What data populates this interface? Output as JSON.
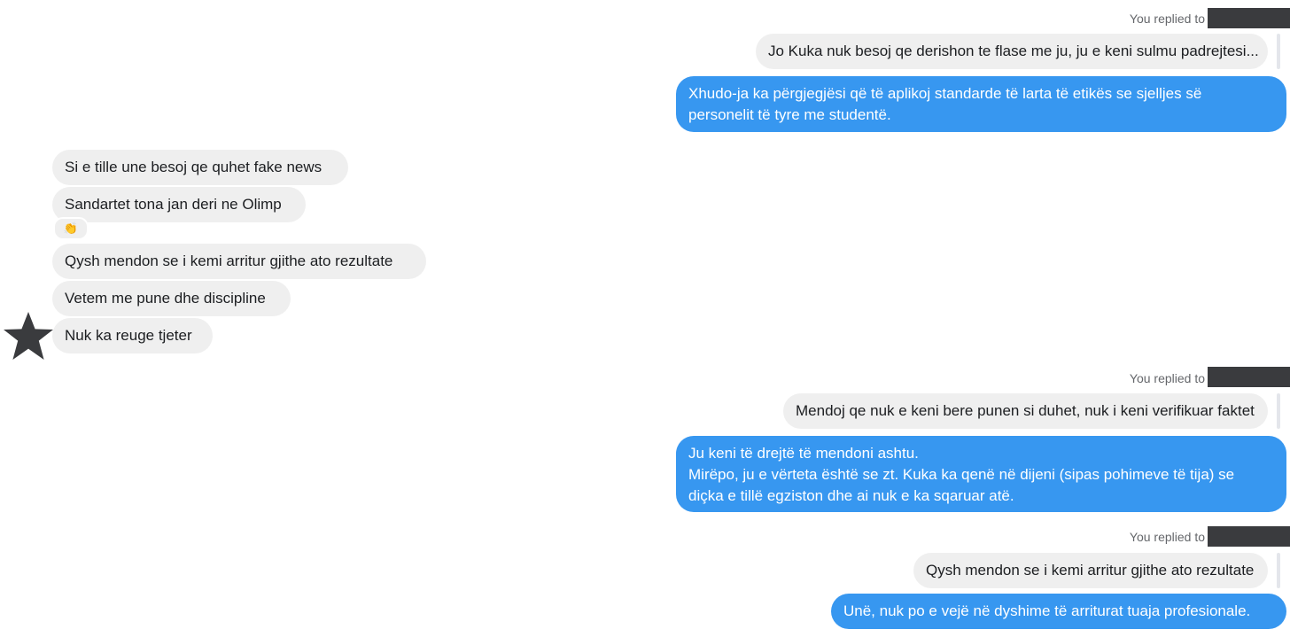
{
  "threads": [
    {
      "reply_label": "You replied to",
      "quoted": "Jo Kuka nuk besoj qe derishon te flase me ju, ju e keni sulmu padrejtesi...",
      "sent": "Xhudo-ja ka përgjegjësi që të aplikoj standarde të larta të etikës se sjelljes së\npersonelit të tyre me studentë."
    },
    {
      "reply_label": "You replied to",
      "quoted": "Mendoj qe nuk e keni bere punen si duhet, nuk i keni verifikuar faktet",
      "sent": "Ju keni të drejtë të mendoni ashtu.\nMirëpo, ju e vërteta është se zt. Kuka ka qenë në dijeni (sipas pohimeve të tija) se\ndiçka e tillë egziston dhe ai nuk e ka sqaruar atë."
    },
    {
      "reply_label": "You replied to",
      "quoted": "Qysh mendon se i kemi arritur gjithe ato rezultate",
      "sent": "Unë, nuk po e vejë në dyshime të arriturat tuaja profesionale."
    }
  ],
  "received": [
    "Si e tille une besoj qe quhet fake news",
    "Sandartet tona jan deri ne Olimp",
    "Qysh mendon se i kemi arritur gjithe ato rezultate",
    "Vetem me pune dhe discipline",
    "Nuk ka reuge tjeter"
  ],
  "reaction": "👏",
  "colors": {
    "sent_bubble": "#3797f0",
    "received_bubble": "#efefef",
    "redaction": "#3a3b3e"
  }
}
